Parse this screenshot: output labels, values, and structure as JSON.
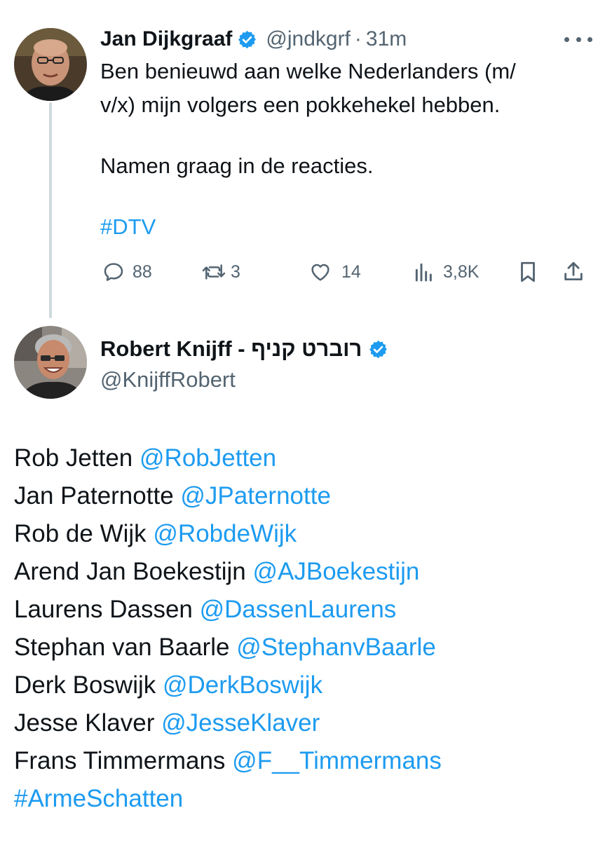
{
  "tweet1": {
    "name": "Jan Dijkgraaf",
    "handle": "@jndkgrf",
    "separator": "·",
    "time": "31m",
    "lines": [
      "Ben benieuwd aan welke Nederlanders (m/",
      "v/x) mijn volgers een pokkehekel hebben.",
      "Namen graag in de reacties."
    ],
    "hashtag": "#DTV",
    "actions": {
      "replies": "88",
      "reposts": "3",
      "likes": "14",
      "views": "3,8K"
    }
  },
  "tweet2": {
    "name": "Robert Knijff - רוברט קניף",
    "handle": "@KnijffRobert",
    "entries": [
      {
        "name": "Rob Jetten",
        "mention": "@RobJetten"
      },
      {
        "name": "Jan Paternotte",
        "mention": "@JPaternotte"
      },
      {
        "name": "Rob de Wijk",
        "mention": "@RobdeWijk"
      },
      {
        "name": "Arend Jan Boekestijn",
        "mention": "@AJBoekestijn"
      },
      {
        "name": "Laurens Dassen",
        "mention": "@DassenLaurens"
      },
      {
        "name": "Stephan van Baarle",
        "mention": "@StephanvBaarle"
      },
      {
        "name": "Derk Boswijk",
        "mention": "@DerkBoswijk"
      },
      {
        "name": "Jesse Klaver",
        "mention": "@JesseKlaver"
      },
      {
        "name": "Frans Timmermans",
        "mention": "@F__Timmermans"
      }
    ],
    "hashtag": "#ArmeSchatten"
  },
  "colors": {
    "accent": "#1d9bf0",
    "muted": "#536471",
    "text": "#0f1419",
    "thread": "#cfd9de"
  }
}
